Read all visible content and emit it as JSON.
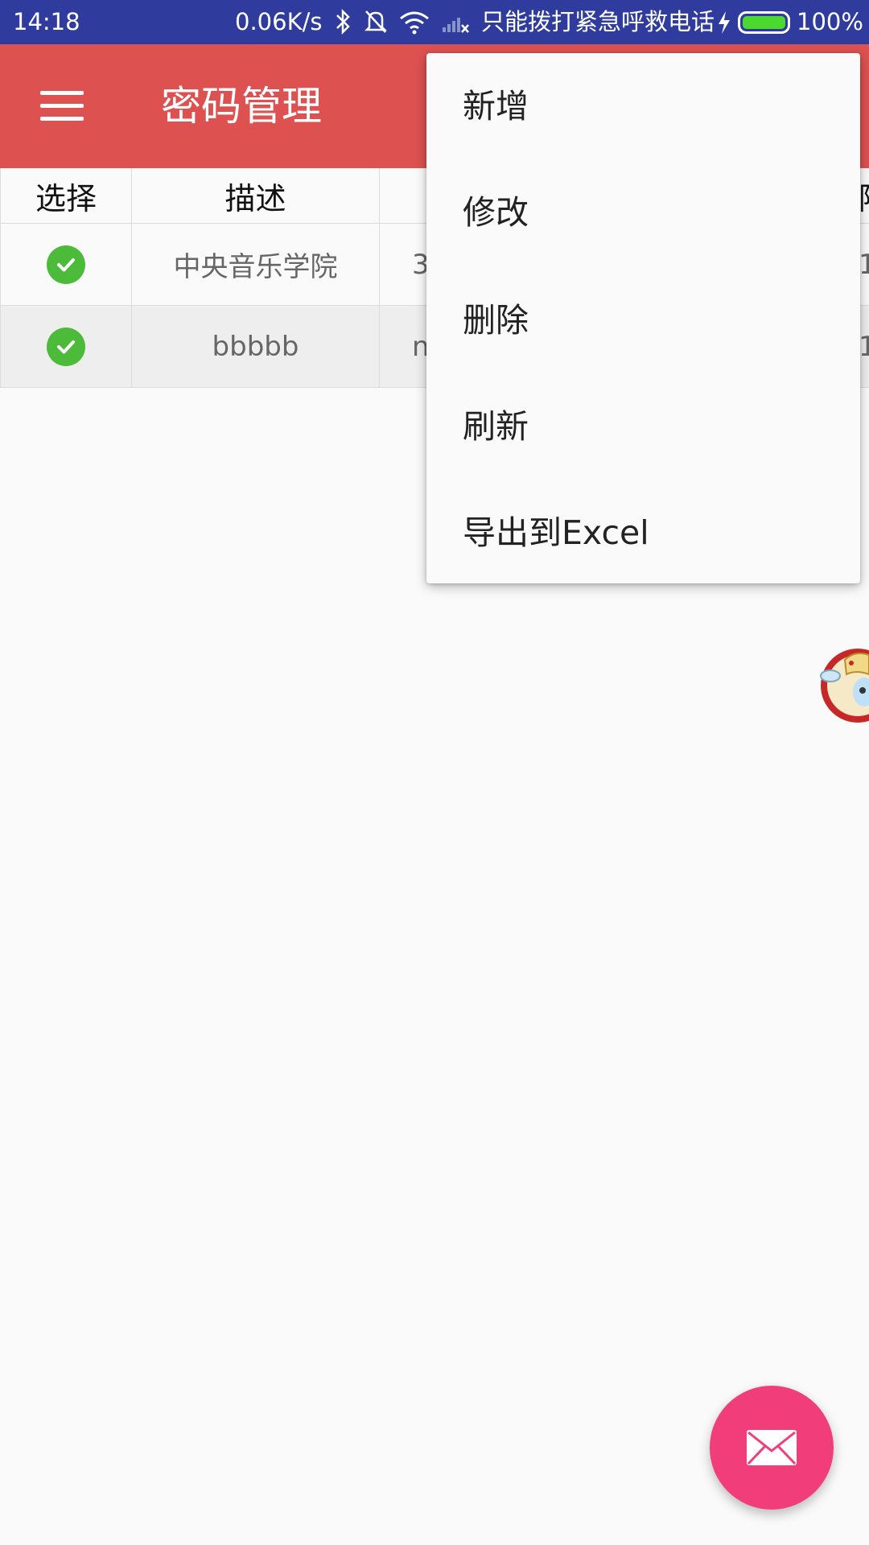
{
  "status_bar": {
    "time": "14:18",
    "net_speed": "0.06K/s",
    "carrier": "只能拨打紧急呼救电话",
    "battery_percent": "100%",
    "icons": [
      "bluetooth-icon",
      "bell-muted-icon",
      "wifi-icon",
      "no-signal-icon",
      "charging-bolt-icon",
      "battery-icon"
    ]
  },
  "app_bar": {
    "menu_icon": "hamburger-icon",
    "title": "密码管理",
    "color": "#dd5151"
  },
  "table": {
    "headers": [
      "选择",
      "描述",
      "",
      "阿"
    ],
    "rows": [
      {
        "selected": true,
        "description": "中央音乐学院",
        "col3_partial": "3",
        "col4_partial": "1"
      },
      {
        "selected": true,
        "description": "bbbbb",
        "col3_partial": "n",
        "col4_partial": "1"
      }
    ]
  },
  "overflow_menu": {
    "items": [
      "新增",
      "修改",
      "删除",
      "刷新",
      "导出到Excel"
    ]
  },
  "fab": {
    "icon": "mail-icon",
    "color": "#f13d7a"
  },
  "floating_widget": {
    "icon": "mascot-icon"
  }
}
